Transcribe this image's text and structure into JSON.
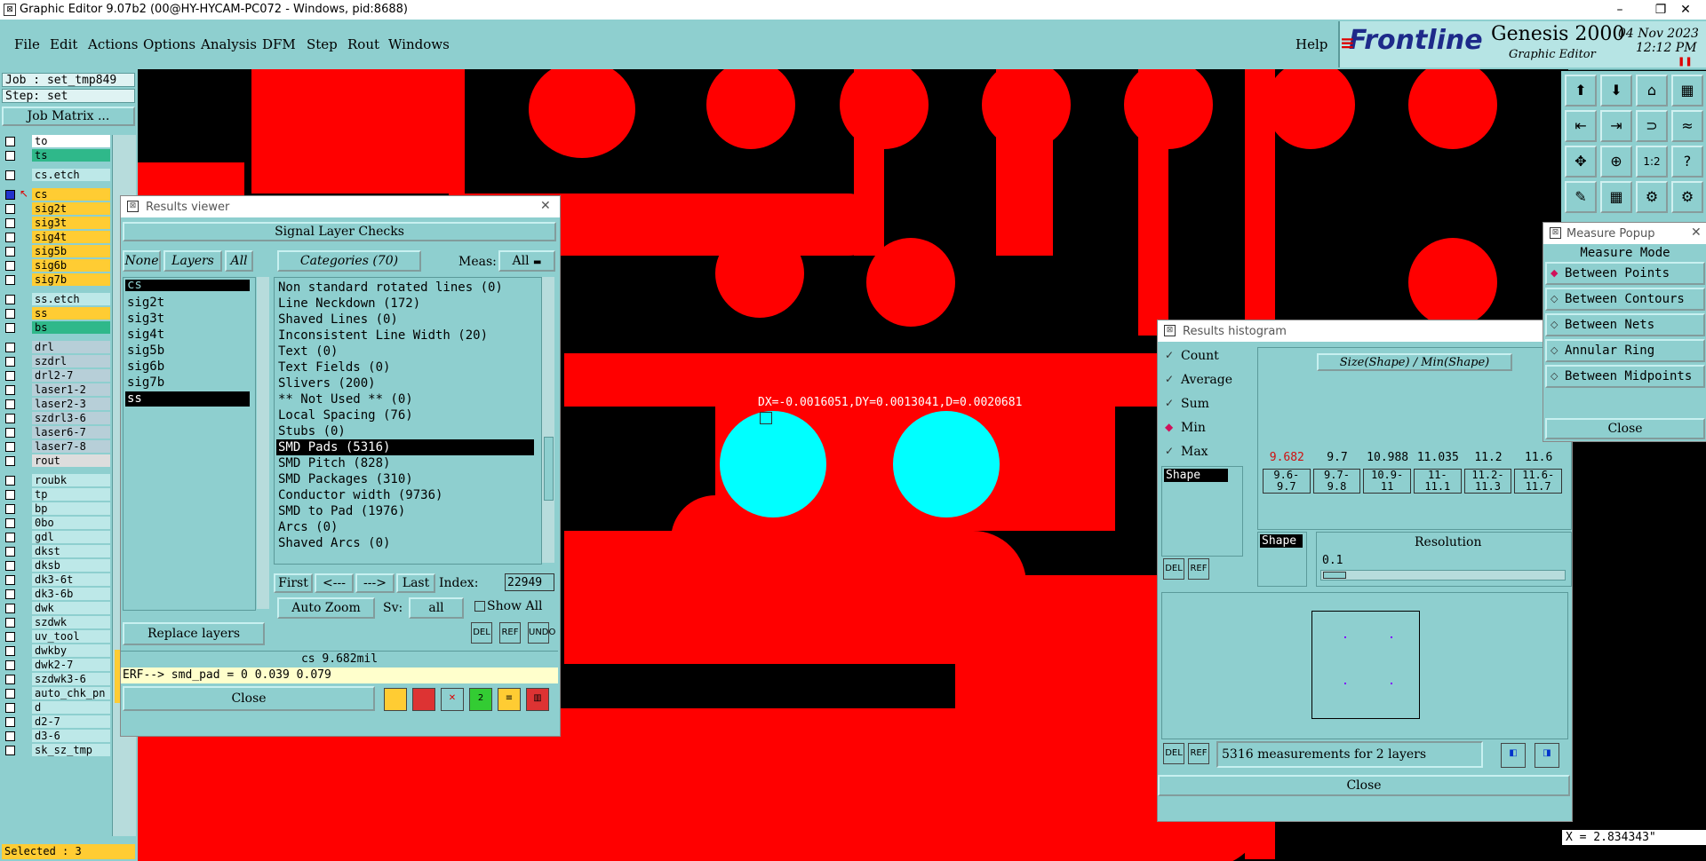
{
  "window": {
    "title": "Graphic Editor 9.07b2 (00@HY-HYCAM-PC072 - Windows, pid:8688)",
    "controls": [
      "–",
      "❐",
      "✕"
    ]
  },
  "menu": {
    "items": [
      "File",
      "Edit",
      "Actions",
      "Options",
      "Analysis",
      "DFM",
      "Step",
      "Rout",
      "Windows"
    ],
    "help": "Help"
  },
  "brand": {
    "logo": "Frontline",
    "product": "Genesis 2000",
    "subtitle": "Graphic Editor",
    "date": "04 Nov 2023",
    "time": "12:12 PM"
  },
  "job": {
    "job_label": "Job : set_tmp849",
    "step_label": "Step: set",
    "matrix_button": "Job Matrix ..."
  },
  "layers": [
    {
      "name": "to",
      "color": "#ffffff"
    },
    {
      "name": "ts",
      "color": "#2fb88a"
    },
    {
      "name": "cs.etch",
      "color": "#bde8e8"
    },
    {
      "name": "cs",
      "color": "#ffcc33"
    },
    {
      "name": "sig2t",
      "color": "#ffcc33"
    },
    {
      "name": "sig3t",
      "color": "#ffcc33"
    },
    {
      "name": "sig4t",
      "color": "#ffcc33"
    },
    {
      "name": "sig5b",
      "color": "#ffcc33"
    },
    {
      "name": "sig6b",
      "color": "#ffcc33"
    },
    {
      "name": "sig7b",
      "color": "#ffcc33"
    },
    {
      "name": "ss.etch",
      "color": "#bde8e8"
    },
    {
      "name": "ss",
      "color": "#ffcc33"
    },
    {
      "name": "bs",
      "color": "#2fb88a"
    },
    {
      "name": "drl",
      "color": "#b7cfd8"
    },
    {
      "name": "szdrl",
      "color": "#b7cfd8"
    },
    {
      "name": "drl2-7",
      "color": "#b7cfd8"
    },
    {
      "name": "laser1-2",
      "color": "#b7cfd8"
    },
    {
      "name": "laser2-3",
      "color": "#b7cfd8"
    },
    {
      "name": "szdrl3-6",
      "color": "#b7cfd8"
    },
    {
      "name": "laser6-7",
      "color": "#b7cfd8"
    },
    {
      "name": "laser7-8",
      "color": "#b7cfd8"
    },
    {
      "name": "rout",
      "color": "#dddddd"
    },
    {
      "name": "roubk",
      "color": "#bde8e8"
    },
    {
      "name": "tp",
      "color": "#bde8e8"
    },
    {
      "name": "bp",
      "color": "#bde8e8"
    },
    {
      "name": "0bo",
      "color": "#bde8e8"
    },
    {
      "name": "gdl",
      "color": "#bde8e8"
    },
    {
      "name": "dkst",
      "color": "#bde8e8"
    },
    {
      "name": "dksb",
      "color": "#bde8e8"
    },
    {
      "name": "dk3-6t",
      "color": "#bde8e8"
    },
    {
      "name": "dk3-6b",
      "color": "#bde8e8"
    },
    {
      "name": "dwk",
      "color": "#bde8e8"
    },
    {
      "name": "szdwk",
      "color": "#bde8e8"
    },
    {
      "name": "uv_tool",
      "color": "#bde8e8"
    },
    {
      "name": "dwkby",
      "color": "#bde8e8"
    },
    {
      "name": "dwk2-7",
      "color": "#bde8e8"
    },
    {
      "name": "szdwk3-6",
      "color": "#bde8e8"
    },
    {
      "name": "auto_chk_pn",
      "color": "#bde8e8"
    },
    {
      "name": "d",
      "color": "#bde8e8"
    },
    {
      "name": "d2-7",
      "color": "#bde8e8"
    },
    {
      "name": "d3-6",
      "color": "#bde8e8"
    },
    {
      "name": "sk_sz_tmp",
      "color": "#bde8e8"
    }
  ],
  "status": {
    "selected": "Selected : 3",
    "coord": "X = 2.834343\""
  },
  "measurement": {
    "readout": "DX=-0.0016051,DY=0.0013041,D=0.0020681"
  },
  "results_viewer": {
    "title": "Results viewer",
    "header": "Signal Layer Checks",
    "btn_none": "None",
    "btn_layers": "Layers",
    "btn_all": "All",
    "categories_btn": "Categories (70)",
    "meas_label": "Meas:",
    "meas_value": "All",
    "layer_list": [
      "cs",
      "sig2t",
      "sig3t",
      "sig4t",
      "sig5b",
      "sig6b",
      "sig7b",
      "ss"
    ],
    "categories": [
      "Non standard rotated lines (0)",
      "Line Neckdown (172)",
      "Shaved Lines (0)",
      "Inconsistent Line Width (20)",
      "Text (0)",
      "Text Fields (0)",
      "Slivers (200)",
      "** Not Used ** (0)",
      "Local Spacing (76)",
      "Stubs (0)",
      "SMD Pads (5316)",
      "SMD Pitch (828)",
      "SMD Packages (310)",
      "Conductor width (9736)",
      "SMD to Pad (1976)",
      "Arcs (0)",
      "Shaved Arcs (0)"
    ],
    "selected_category": "SMD Pads (5316)",
    "nav": {
      "first": "First",
      "prev": "<---",
      "next": "--->",
      "last": "Last",
      "index_label": "Index:",
      "index_value": "22949"
    },
    "zoom_btn": "Auto Zoom",
    "sv_label": "Sv:",
    "sv_value": "all",
    "show_all": "Show All",
    "replace_layers": "Replace layers",
    "icon_labels": [
      "DEL",
      "REF",
      "UNDO"
    ],
    "info_line": "cs 9.682mil",
    "erf_line": "ERF--> smd_pad = 0 0.039 0.079",
    "close": "Close"
  },
  "histogram": {
    "title": "Results histogram",
    "options": [
      {
        "label": "Count",
        "checked": false
      },
      {
        "label": "Average",
        "checked": false
      },
      {
        "label": "Sum",
        "checked": false
      },
      {
        "label": "Min",
        "checked": true
      },
      {
        "label": "Max",
        "checked": false
      }
    ],
    "shape_item": "Shape",
    "chart_header": "Size(Shape) / Min(Shape)",
    "bins": [
      {
        "value": "9.682",
        "range": "9.6- 9.7",
        "highlight": true
      },
      {
        "value": "9.7",
        "range": "9.7- 9.8",
        "highlight": false
      },
      {
        "value": "10.988",
        "range": "10.9- 11",
        "highlight": false
      },
      {
        "value": "11.035",
        "range": "11- 11.1",
        "highlight": false
      },
      {
        "value": "11.2",
        "range": "11.2- 11.3",
        "highlight": false
      },
      {
        "value": "11.6",
        "range": "11.6- 11.7",
        "highlight": false
      }
    ],
    "shape_label": "Shape",
    "resolution_label": "Resolution",
    "resolution_value": "0.1",
    "summary": "5316 measurements for 2 layers",
    "del": "DEL",
    "ref": "REF",
    "close": "Close"
  },
  "measure_popup": {
    "title": "Measure Popup",
    "header": "Measure Mode",
    "modes": [
      {
        "label": "Between Points",
        "selected": true
      },
      {
        "label": "Between Contours",
        "selected": false
      },
      {
        "label": "Between Nets",
        "selected": false
      },
      {
        "label": "Annular Ring",
        "selected": false
      },
      {
        "label": "Between Midpoints",
        "selected": false
      }
    ],
    "close": "Close"
  },
  "toolbar_right": {
    "buttons": [
      "⬆",
      "⬇",
      "⌂",
      "▦",
      "⇤",
      "⇥",
      "⊃",
      "≈",
      "✥",
      "⊕",
      "1:2",
      "?",
      "✎",
      "▦",
      "⚙",
      "⚙"
    ]
  }
}
